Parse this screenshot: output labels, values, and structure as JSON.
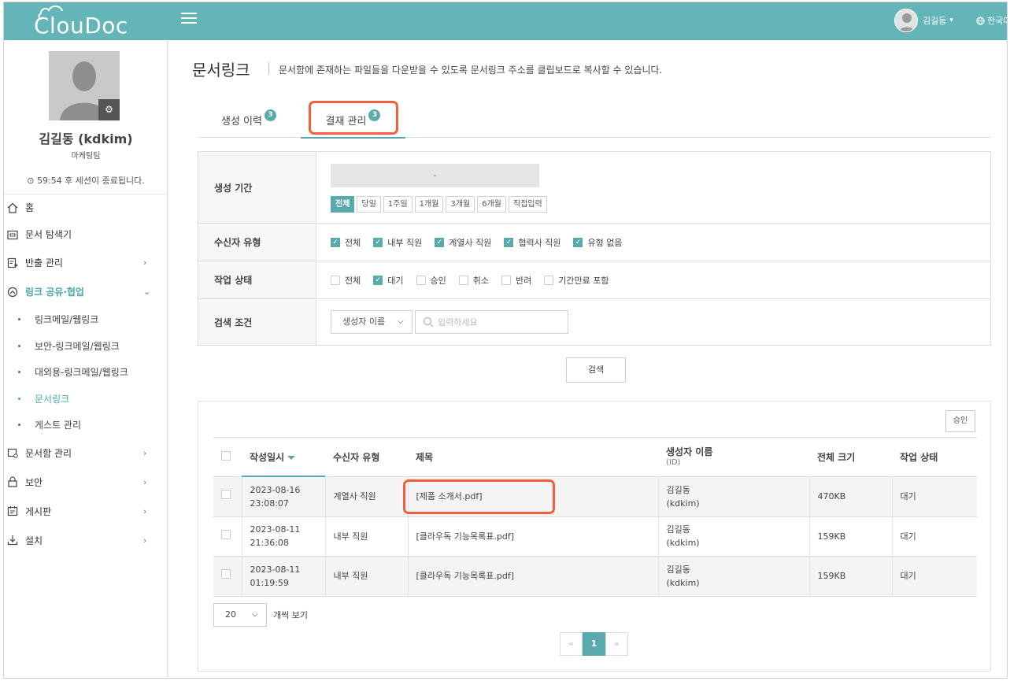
{
  "app": {
    "logo": "ClouDoc"
  },
  "header": {
    "user_name": "김길동",
    "user_caret": "▾",
    "language": "한국어"
  },
  "profile": {
    "name": "김길동 (kdkim)",
    "dept": "마케팅팀",
    "session": "59:54 후 세션이 종료됩니다."
  },
  "nav": {
    "home": "홈",
    "explorer": "문서 탐색기",
    "export": "반출 관리",
    "link_share": "링크 공유·협업",
    "sub": [
      "링크메일/웹링크",
      "보안-링크메일/웹링크",
      "대외용-링크메일/웹링크",
      "문서링크",
      "게스트 관리"
    ],
    "doc_mgmt": "문서함 관리",
    "security": "보안",
    "board": "게시판",
    "install": "설치"
  },
  "page": {
    "title": "문서링크",
    "description": "문서함에 존재하는 파일들을 다운받을 수 있도록 문서링크 주소를 클립보드로 복사할 수 있습니다."
  },
  "tabs": [
    {
      "label": "생성 이력",
      "count": "3"
    },
    {
      "label": "결재 관리",
      "count": "3"
    }
  ],
  "filter": {
    "period_label": "생성 기간",
    "date_value": "-",
    "ranges": [
      "전체",
      "당일",
      "1주일",
      "1개월",
      "3개월",
      "6개월",
      "직접입력"
    ],
    "recipient_label": "수신자 유형",
    "recipient_options": [
      "전체",
      "내부 직원",
      "계열사 직원",
      "협력사 직원",
      "유형 없음"
    ],
    "status_label": "작업 상태",
    "status_options": [
      "전체",
      "대기",
      "승인",
      "취소",
      "반려",
      "기간만료 포함"
    ],
    "search_label": "검색 조건",
    "search_field": "생성자 이름",
    "search_placeholder": "입력하세요",
    "search_button": "검색"
  },
  "results": {
    "approve_button": "승인",
    "columns": {
      "date": "작성일시",
      "recipient": "수신자 유형",
      "title": "제목",
      "creator": "생성자 이름",
      "creator_sub": "(ID)",
      "size": "전체 크기",
      "status": "작업 상태"
    },
    "rows": [
      {
        "date": "2023-08-16",
        "time": "23:08:07",
        "recipient": "계열사 직원",
        "title": "[제품 소개서.pdf]",
        "creator": "김길동",
        "creator_id": "(kdkim)",
        "size": "470KB",
        "status": "대기"
      },
      {
        "date": "2023-08-11",
        "time": "21:36:08",
        "recipient": "내부 직원",
        "title": "[클라우독 기능목록표.pdf]",
        "creator": "김길동",
        "creator_id": "(kdkim)",
        "size": "159KB",
        "status": "대기"
      },
      {
        "date": "2023-08-11",
        "time": "01:19:59",
        "recipient": "내부 직원",
        "title": "[클라우독 기능목록표.pdf]",
        "creator": "김길동",
        "creator_id": "(kdkim)",
        "size": "159KB",
        "status": "대기"
      }
    ],
    "page_size": "20",
    "page_size_label": "개씩 보기",
    "pager": {
      "prev": "«",
      "current": "1",
      "next": "»"
    }
  },
  "colors": {
    "header": "#63b5b8",
    "accent": "#5aa9ac",
    "highlight": "#f0603c"
  }
}
